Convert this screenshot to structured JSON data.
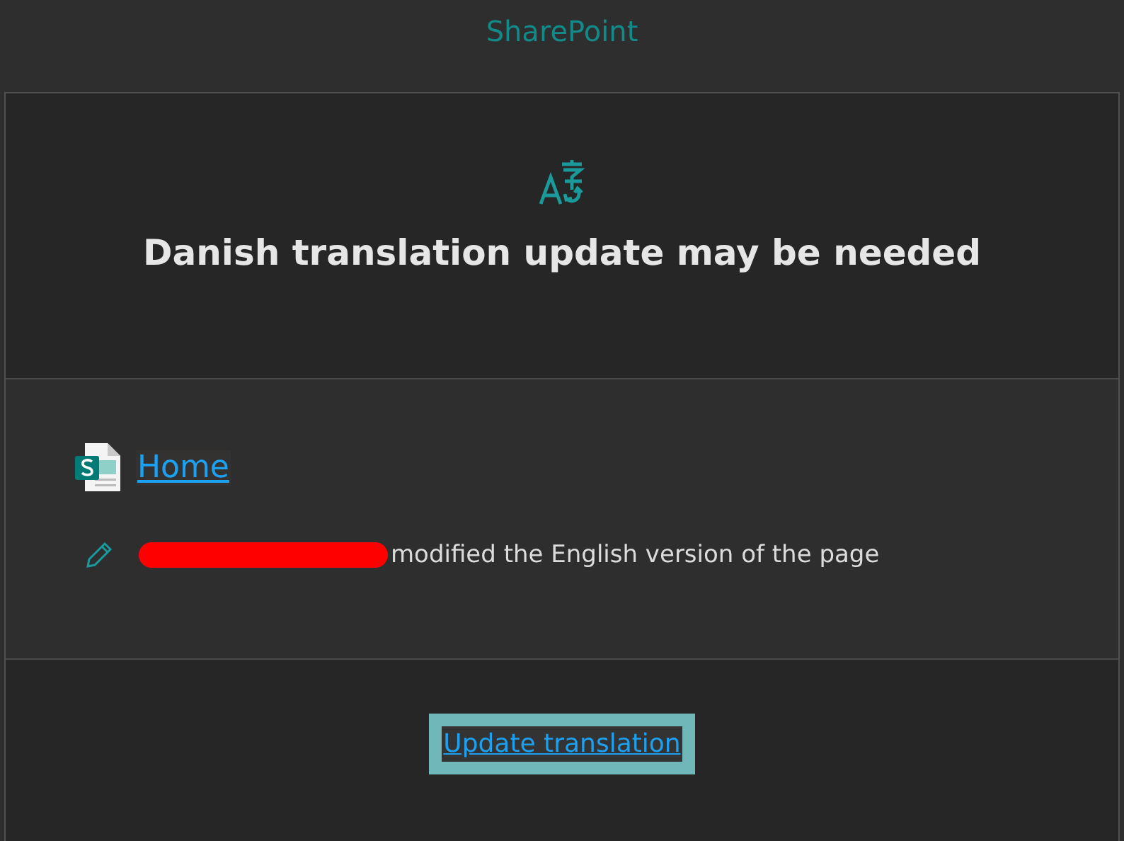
{
  "header": {
    "title": "SharePoint"
  },
  "banner": {
    "heading": "Danish translation update may be needed"
  },
  "page_link": {
    "label": "Home"
  },
  "activity": {
    "text": "modified the English version of the page",
    "author_redacted": true
  },
  "action": {
    "label": "Update translation"
  }
}
